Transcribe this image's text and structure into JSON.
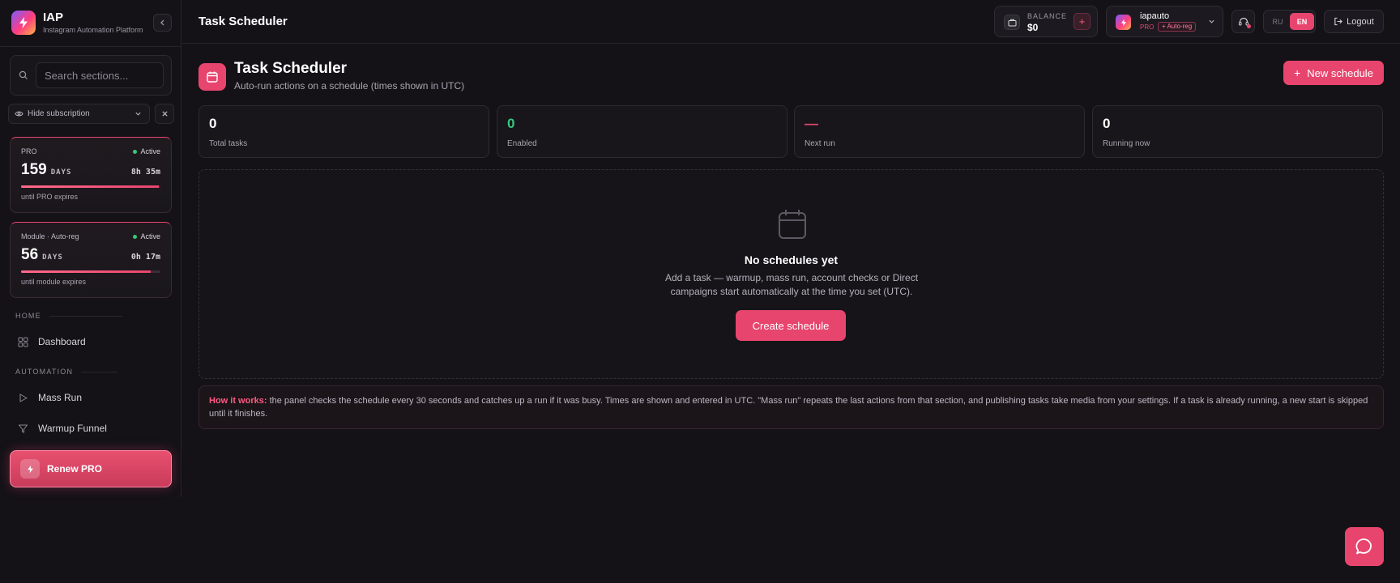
{
  "brand": {
    "name": "IAP",
    "subtitle": "Instagram Automation Platform"
  },
  "sidebar": {
    "search_placeholder": "Search sections...",
    "hide_subscription_label": "Hide subscription",
    "subscriptions": [
      {
        "tier": "PRO",
        "status": "Active",
        "days": "159",
        "days_label": "DAYS",
        "time": "8h 35m",
        "note": "until PRO expires",
        "progress": 0.99
      },
      {
        "tier": "Module · Auto-reg",
        "status": "Active",
        "days": "56",
        "days_label": "DAYS",
        "time": "0h 17m",
        "note": "until module expires",
        "progress": 0.93
      }
    ],
    "sections": [
      {
        "label": "HOME",
        "items": [
          {
            "label": "Dashboard",
            "icon": "grid-icon"
          }
        ]
      },
      {
        "label": "AUTOMATION",
        "items": [
          {
            "label": "Mass Run",
            "icon": "play-icon"
          },
          {
            "label": "Warmup Funnel",
            "icon": "funnel-icon"
          }
        ]
      }
    ],
    "renew_label": "Renew PRO"
  },
  "topbar": {
    "title": "Task Scheduler",
    "balance_label": "BALANCE",
    "balance_value": "$0",
    "balance_add": "+",
    "username": "iapauto",
    "user_tier": "PRO",
    "user_badge": "+ Auto-reg",
    "lang_ru": "RU",
    "lang_en": "EN",
    "logout_label": "Logout"
  },
  "page": {
    "title": "Task Scheduler",
    "subtitle": "Auto-run actions on a schedule (times shown in UTC)",
    "new_button": "New schedule",
    "stats": [
      {
        "value": "0",
        "label": "Total tasks",
        "color": "#ffffff"
      },
      {
        "value": "0",
        "label": "Enabled",
        "color": "#37c77f"
      },
      {
        "value": "—",
        "label": "Next run",
        "color": "#e8456e"
      },
      {
        "value": "0",
        "label": "Running now",
        "color": "#ffffff"
      }
    ],
    "empty": {
      "title": "No schedules yet",
      "description": "Add a task — warmup, mass run, account checks or Direct campaigns start automatically at the time you set (UTC).",
      "button": "Create schedule"
    },
    "info": {
      "key": "How it works:",
      "text": " the panel checks the schedule every 30 seconds and catches up a run if it was busy. Times are shown and entered in UTC. \"Mass run\" repeats the last actions from that section, and publishing tasks take media from your settings. If a task is already running, a new start is skipped until it finishes."
    }
  },
  "colors": {
    "accent": "#e8456e",
    "success": "#37c77f",
    "background": "#141217"
  }
}
